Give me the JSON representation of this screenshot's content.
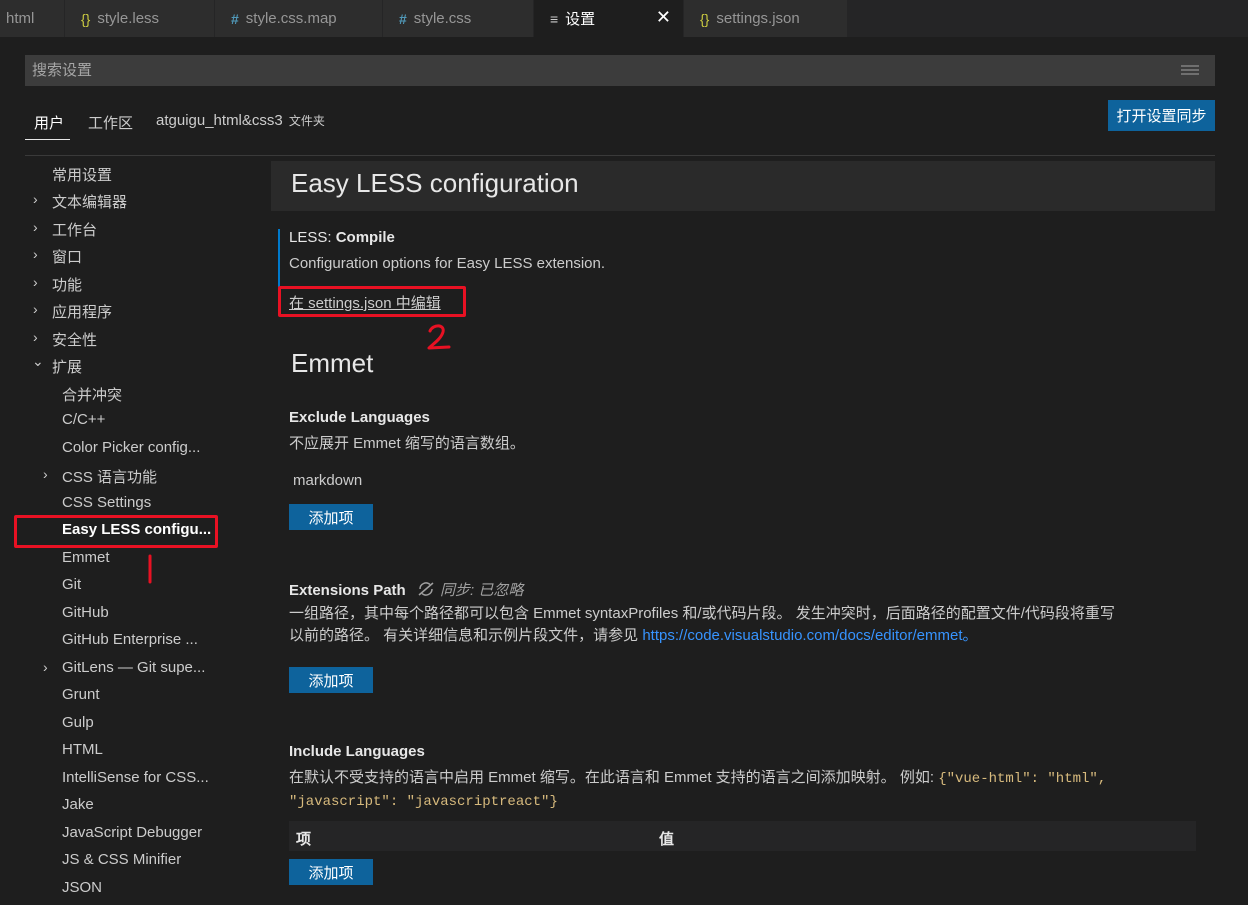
{
  "tabs": [
    {
      "icon": "",
      "label": "html"
    },
    {
      "icon": "{}",
      "label": "style.less"
    },
    {
      "icon": "#",
      "label": "style.css.map"
    },
    {
      "icon": "#",
      "label": "style.css"
    },
    {
      "icon": "≡",
      "label": "设置",
      "close": "✕"
    },
    {
      "icon": "{}",
      "label": "settings.json"
    }
  ],
  "search": {
    "placeholder": "搜索设置"
  },
  "scope_tabs": {
    "user": "用户",
    "workspace": "工作区",
    "folder": "atguigu_html&css3",
    "folder_suffix": "文件夹"
  },
  "sync_button": "打开设置同步",
  "toc": {
    "items": [
      {
        "label": "常用设置"
      },
      {
        "label": "文本编辑器",
        "chevron": "›"
      },
      {
        "label": "工作台",
        "chevron": "›"
      },
      {
        "label": "窗口",
        "chevron": "›"
      },
      {
        "label": "功能",
        "chevron": "›"
      },
      {
        "label": "应用程序",
        "chevron": "›"
      },
      {
        "label": "安全性",
        "chevron": "›"
      },
      {
        "label": "扩展",
        "chevron": "⌄"
      },
      {
        "label": "合并冲突"
      },
      {
        "label": "C/C++"
      },
      {
        "label": "Color Picker config..."
      },
      {
        "label": "CSS 语言功能",
        "chevron": "›"
      },
      {
        "label": "CSS Settings"
      },
      {
        "label": "Easy LESS configu..."
      },
      {
        "label": "Emmet"
      },
      {
        "label": "Git"
      },
      {
        "label": "GitHub"
      },
      {
        "label": "GitHub Enterprise ..."
      },
      {
        "label": "GitLens — Git supe...",
        "chevron": "›"
      },
      {
        "label": "Grunt"
      },
      {
        "label": "Gulp"
      },
      {
        "label": "HTML"
      },
      {
        "label": "IntelliSense for CSS..."
      },
      {
        "label": "Jake"
      },
      {
        "label": "JavaScript Debugger"
      },
      {
        "label": "JS & CSS Minifier"
      },
      {
        "label": "JSON"
      }
    ]
  },
  "content": {
    "group_title": "Easy LESS configuration",
    "less_compile": {
      "category": "LESS: ",
      "name": "Compile",
      "description": "Configuration options for Easy LESS extension.",
      "edit_link": "在 settings.json 中编辑"
    },
    "emmet_title": "Emmet",
    "exclude_languages": {
      "title": "Exclude Languages",
      "description": "不应展开 Emmet 缩写的语言数组。",
      "value": "markdown",
      "add_button": "添加项"
    },
    "extensions_path": {
      "title": "Extensions Path",
      "sync_ignored": "同步: 已忽略",
      "description_line1": "一组路径，其中每个路径都可以包含 Emmet syntaxProfiles 和/或代码片段。 发生冲突时，后面路径的配置文件/代码段将重写",
      "description_line2_prefix": "以前的路径。 有关详细信息和示例片段文件，请参见 ",
      "link": "https://code.visualstudio.com/docs/editor/emmet",
      "description_line2_suffix": "。",
      "add_button": "添加项"
    },
    "include_languages": {
      "title": "Include Languages",
      "description_prefix": "在默认不受支持的语言中启用 Emmet 缩写。在此语言和 Emmet 支持的语言之间添加映射。 例如: ",
      "code_line1": "{\"vue-html\": \"html\",",
      "code_line2": "\"javascript\": \"javascriptreact\"}",
      "col_key": "项",
      "col_value": "值",
      "add_button": "添加项"
    }
  },
  "annotations": {
    "mark1": "1",
    "mark2": "2",
    "color": "#e81123"
  },
  "colors": {
    "accent": "#0e639c",
    "link": "#3794ff",
    "focus": "#007acc"
  }
}
